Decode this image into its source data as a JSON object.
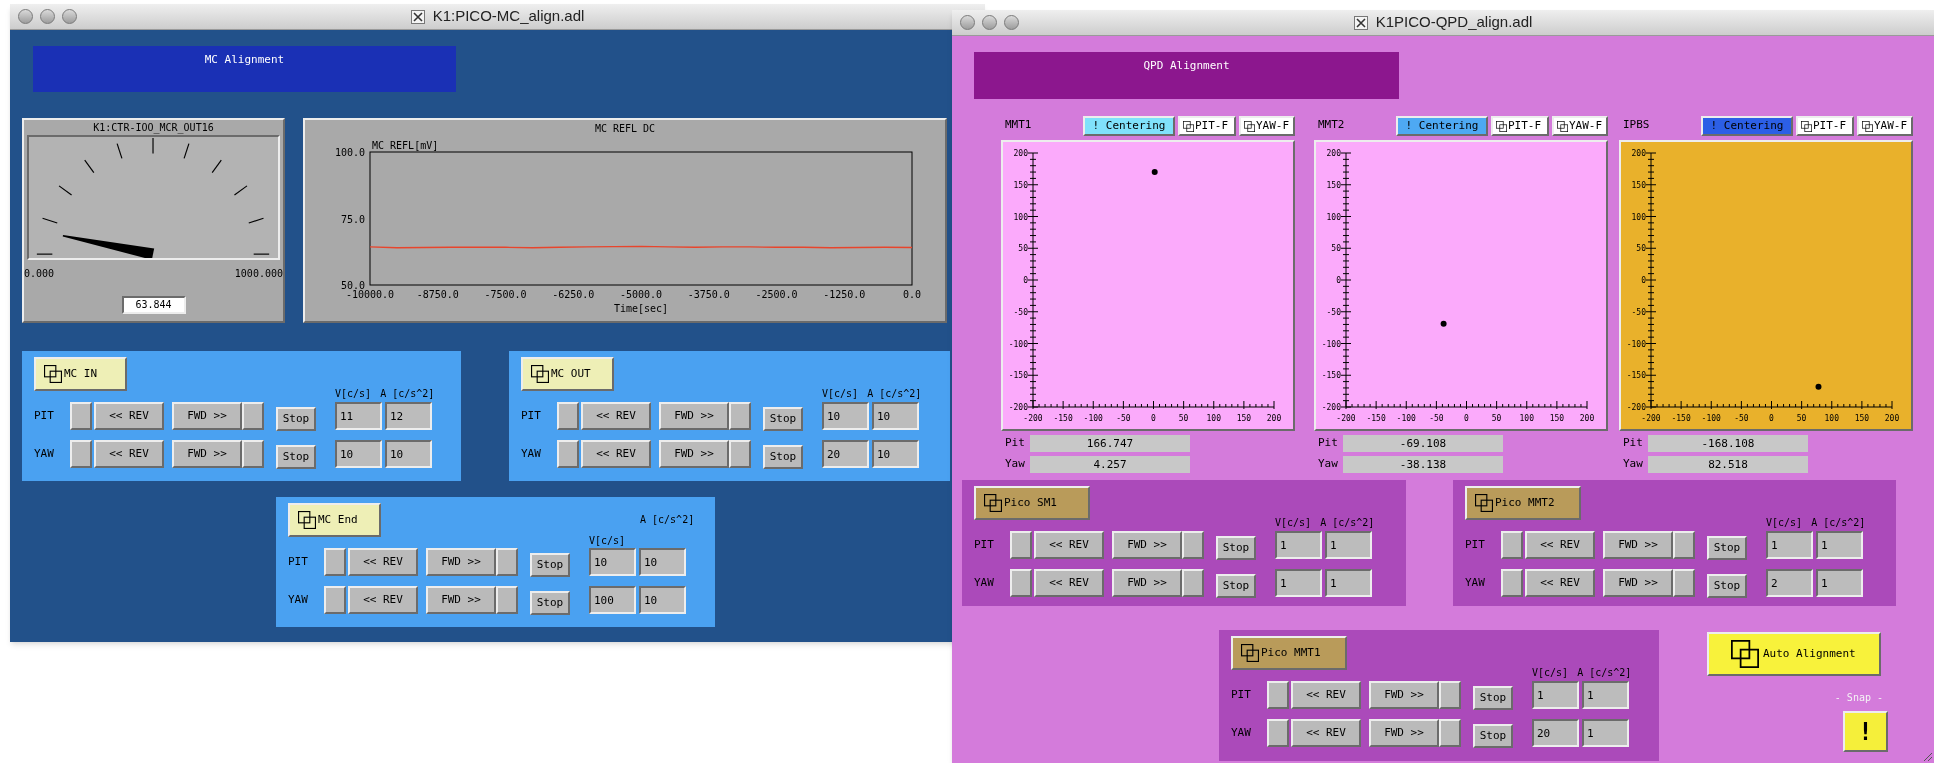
{
  "mc_window": {
    "title": "K1:PICO-MC_align.adl",
    "banner": "MC Alignment",
    "meter": {
      "title": "K1:CTR-IOO_MCR_OUT16",
      "min_label": "0.000",
      "max_label": "1000.000",
      "reading": "63.844"
    },
    "chart": {
      "chart_data": {
        "type": "line",
        "title": "MC REFL DC",
        "xlabel": "Time[sec]",
        "ylabel": "MC REFL[mV]",
        "x": [
          -10000,
          -9500,
          -9000,
          -8500,
          -8000,
          -7500,
          -7000,
          -6500,
          -6000,
          -5500,
          -5000,
          -4500,
          -4000,
          -3500,
          -3000,
          -2500,
          -2000,
          -1500,
          -1000,
          -500,
          0
        ],
        "series": [
          {
            "color": "#e8452c",
            "values": [
              64.3,
              64.0,
              64.1,
              64.2,
              64.2,
              64.2,
              64.0,
              64.2,
              64.3,
              64.4,
              64.5,
              64.3,
              64.2,
              64.3,
              64.3,
              64.2,
              64.2,
              64.0,
              64.1,
              64.2,
              64.1
            ]
          }
        ],
        "xlim": [
          -10000,
          0
        ],
        "ylim": [
          50,
          100
        ],
        "xticks": [
          {
            "value": -10000,
            "label": "-10000.0"
          },
          {
            "value": -8750,
            "label": "-8750.0"
          },
          {
            "value": -7500,
            "label": "-7500.0"
          },
          {
            "value": -6250,
            "label": "-6250.0"
          },
          {
            "value": -5000,
            "label": "-5000.0"
          },
          {
            "value": -3750,
            "label": "-3750.0"
          },
          {
            "value": -2500,
            "label": "-2500.0"
          },
          {
            "value": -1250,
            "label": "-1250.0"
          },
          {
            "value": 0,
            "label": "0.0"
          }
        ],
        "yticks": [
          {
            "value": 50,
            "label": "50.0"
          },
          {
            "value": 75,
            "label": "75.0"
          },
          {
            "value": 100,
            "label": "100.0"
          }
        ]
      }
    },
    "panels": [
      {
        "title": "MC IN",
        "kind": "inline",
        "v_label": "V[c/s]",
        "a_label": "A [c/s^2]",
        "rows": [
          {
            "axis": "PIT",
            "rev": "<< REV",
            "fwd": "FWD >>",
            "stop": "Stop",
            "v": "11",
            "a": "12"
          },
          {
            "axis": "YAW",
            "rev": "<< REV",
            "fwd": "FWD >>",
            "stop": "Stop",
            "v": "10",
            "a": "10"
          }
        ]
      },
      {
        "title": "MC OUT",
        "kind": "inline",
        "v_label": "V[c/s]",
        "a_label": "A [c/s^2]",
        "rows": [
          {
            "axis": "PIT",
            "rev": "<< REV",
            "fwd": "FWD >>",
            "stop": "Stop",
            "v": "10",
            "a": "10"
          },
          {
            "axis": "YAW",
            "rev": "<< REV",
            "fwd": "FWD >>",
            "stop": "Stop",
            "v": "20",
            "a": "10"
          }
        ]
      },
      {
        "title": "MC End",
        "kind": "stacked",
        "v_label": "V[c/s]",
        "a_label": "A [c/s^2]",
        "rows": [
          {
            "axis": "PIT",
            "rev": "<< REV",
            "fwd": "FWD >>",
            "stop": "Stop",
            "v": "10",
            "a": "10"
          },
          {
            "axis": "YAW",
            "rev": "<< REV",
            "fwd": "FWD >>",
            "stop": "Stop",
            "v": "100",
            "a": "10"
          }
        ]
      }
    ]
  },
  "qpd_window": {
    "title": "K1PICO-QPD_align.adl",
    "banner": "QPD Alignment",
    "plots": [
      {
        "label": "MMT1",
        "centering": {
          "text": "! Centering",
          "color": "#80e1fb"
        },
        "pit_f": "PIT-F",
        "yaw_f": "YAW-F",
        "color": "#fbaafb",
        "pit_label": "Pit",
        "pit": "166.747",
        "yaw_label": "Yaw",
        "yaw": "4.257",
        "chart_data": {
          "type": "scatter",
          "x": [
            2
          ],
          "series": [
            {
              "color": "#000000",
              "values": [
                170
              ]
            }
          ],
          "xlim": [
            -200,
            200
          ],
          "ylim": [
            -200,
            200
          ],
          "xticks": [
            -200,
            -150,
            -100,
            -50,
            0,
            50,
            100,
            150,
            200
          ],
          "yticks": [
            -200,
            -150,
            -100,
            -50,
            0,
            50,
            100,
            150,
            200
          ]
        }
      },
      {
        "label": "MMT2",
        "centering": {
          "text": "! Centering",
          "color": "#4ea9f3"
        },
        "pit_f": "PIT-F",
        "yaw_f": "YAW-F",
        "color": "#fbaafb",
        "pit_label": "Pit",
        "pit": "-69.108",
        "yaw_label": "Yaw",
        "yaw": "-38.138",
        "chart_data": {
          "type": "scatter",
          "x": [
            -38
          ],
          "series": [
            {
              "color": "#000000",
              "values": [
                -69
              ]
            }
          ],
          "xlim": [
            -200,
            200
          ],
          "ylim": [
            -200,
            200
          ],
          "xticks": [
            -200,
            -150,
            -100,
            -50,
            0,
            50,
            100,
            150,
            200
          ],
          "yticks": [
            -200,
            -150,
            -100,
            -50,
            0,
            50,
            100,
            150,
            200
          ]
        }
      },
      {
        "label": "IPBS",
        "centering": {
          "text": "! Centering",
          "color": "#2c5fe6"
        },
        "pit_f": "PIT-F",
        "yaw_f": "YAW-F",
        "color": "#e9b12b",
        "pit_label": "Pit",
        "pit": "-168.108",
        "yaw_label": "Yaw",
        "yaw": "82.518",
        "chart_data": {
          "type": "scatter",
          "x": [
            78
          ],
          "series": [
            {
              "color": "#000000",
              "values": [
                -168
              ]
            }
          ],
          "xlim": [
            -200,
            200
          ],
          "ylim": [
            -200,
            200
          ],
          "xticks": [
            -200,
            -150,
            -100,
            -50,
            0,
            50,
            100,
            150,
            200
          ],
          "yticks": [
            -200,
            -150,
            -100,
            -50,
            0,
            50,
            100,
            150,
            200
          ]
        }
      }
    ],
    "panels": [
      {
        "title": "Pico SM1",
        "kind": "inline",
        "v_label": "V[c/s]",
        "a_label": "A [c/s^2]",
        "rows": [
          {
            "axis": "PIT",
            "rev": "<< REV",
            "fwd": "FWD >>",
            "stop": "Stop",
            "v": "1",
            "a": "1"
          },
          {
            "axis": "YAW",
            "rev": "<< REV",
            "fwd": "FWD >>",
            "stop": "Stop",
            "v": "1",
            "a": "1"
          }
        ]
      },
      {
        "title": "Pico MMT2",
        "kind": "inline",
        "v_label": "V[c/s]",
        "a_label": "A [c/s^2]",
        "rows": [
          {
            "axis": "PIT",
            "rev": "<< REV",
            "fwd": "FWD >>",
            "stop": "Stop",
            "v": "1",
            "a": "1"
          },
          {
            "axis": "YAW",
            "rev": "<< REV",
            "fwd": "FWD >>",
            "stop": "Stop",
            "v": "2",
            "a": "1"
          }
        ]
      },
      {
        "title": "Pico MMT1",
        "kind": "inline",
        "v_label": "V[c/s]",
        "a_label": "A [c/s^2]",
        "rows": [
          {
            "axis": "PIT",
            "rev": "<< REV",
            "fwd": "FWD >>",
            "stop": "Stop",
            "v": "1",
            "a": "1"
          },
          {
            "axis": "YAW",
            "rev": "<< REV",
            "fwd": "FWD >>",
            "stop": "Stop",
            "v": "20",
            "a": "1"
          }
        ]
      }
    ],
    "auto_button": "Auto Alignment",
    "snap_label": "- Snap -",
    "snap_button": "!"
  }
}
